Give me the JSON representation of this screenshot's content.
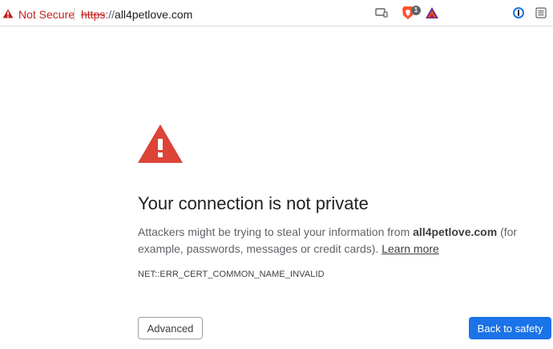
{
  "toolbar": {
    "security_label": "Not Secure",
    "url_scheme": "https",
    "url_separator": "://",
    "url_host": "all4petlove.com",
    "brave_shield_count": "1",
    "icons": [
      "warning-icon",
      "cast-icon",
      "brave-shields-icon",
      "brave-rewards-icon",
      "password-manager-icon",
      "menu-icon"
    ]
  },
  "interstitial": {
    "heading": "Your connection is not private",
    "explanation_before": "Attackers might be trying to steal your information from ",
    "domain": "all4petlove.com",
    "explanation_after": " (for example, passwords, messages or credit cards). ",
    "learn_more": "Learn more",
    "error_code": "NET::ERR_CERT_COMMON_NAME_INVALID",
    "advanced_label": "Advanced",
    "back_label": "Back to safety"
  },
  "colors": {
    "warning_red": "#db4437",
    "insecure_text": "#c5221f",
    "primary_button": "#1a73e8"
  }
}
